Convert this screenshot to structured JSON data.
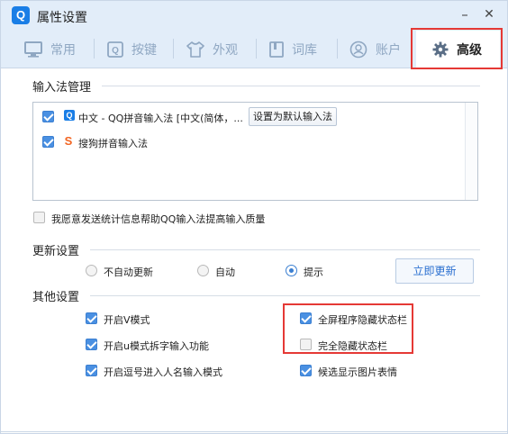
{
  "window": {
    "title": "属性设置",
    "logo": "Q",
    "minimize": "–",
    "close": "✕"
  },
  "tabs": [
    {
      "label": "常用",
      "icon": "monitor-icon"
    },
    {
      "label": "按键",
      "icon": "key-icon"
    },
    {
      "label": "外观",
      "icon": "shirt-icon"
    },
    {
      "label": "词库",
      "icon": "book-icon"
    },
    {
      "label": "账户",
      "icon": "user-icon"
    },
    {
      "label": "高级",
      "icon": "gear-icon",
      "active": true
    }
  ],
  "ime": {
    "title": "输入法管理",
    "items": [
      {
        "label": "中文 - QQ拼音输入法 [中文(简体，...",
        "checked": true,
        "icon": "qq-icon",
        "icon_text": "Q"
      },
      {
        "label": "搜狗拼音输入法",
        "checked": true,
        "icon": "sogou-icon",
        "icon_text": "S"
      }
    ],
    "set_default_button": "设置为默认输入法",
    "stats_checkbox": {
      "label": "我愿意发送统计信息帮助QQ输入法提高输入质量",
      "checked": false
    }
  },
  "update": {
    "title": "更新设置",
    "options": [
      {
        "label": "不自动更新",
        "selected": false
      },
      {
        "label": "自动",
        "selected": false
      },
      {
        "label": "提示",
        "selected": true
      }
    ],
    "update_now_button": "立即更新"
  },
  "other": {
    "title": "其他设置",
    "left": [
      {
        "label": "开启V模式",
        "checked": true
      },
      {
        "label": "开启u模式拆字输入功能",
        "checked": true
      },
      {
        "label": "开启逗号进入人名输入模式",
        "checked": true
      }
    ],
    "right": [
      {
        "label": "全屏程序隐藏状态栏",
        "checked": true
      },
      {
        "label": "完全隐藏状态栏",
        "checked": false
      },
      {
        "label": "候选显示图片表情",
        "checked": true
      }
    ]
  },
  "colors": {
    "accent": "#4a90e2",
    "highlight": "#e53935",
    "titlebar": "#e2edf9"
  }
}
